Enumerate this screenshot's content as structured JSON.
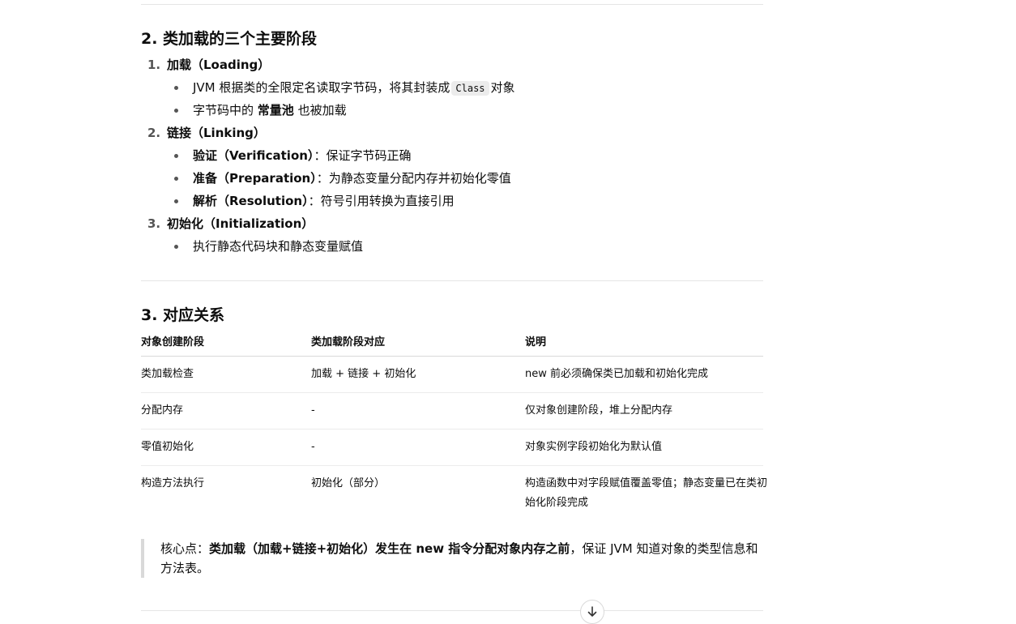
{
  "section2": {
    "title": "2. 类加载的三个主要阶段",
    "items": [
      {
        "num": "1.",
        "label": "加载（Loading）",
        "bullets": [
          {
            "pre": "JVM 根据类的全限定名读取字节码，将其封装成",
            "code": "Class",
            "post": "对象"
          },
          {
            "pre": "字节码中的",
            "bold": "常量池",
            "post": "也被加载"
          }
        ]
      },
      {
        "num": "2.",
        "label": "链接（Linking）",
        "bullets": [
          {
            "bold": "验证（Verification）",
            "post": "：保证字节码正确"
          },
          {
            "bold": "准备（Preparation）",
            "post": "：为静态变量分配内存并初始化零值"
          },
          {
            "bold": "解析（Resolution）",
            "post": "：符号引用转换为直接引用"
          }
        ]
      },
      {
        "num": "3.",
        "label": "初始化（Initialization）",
        "bullets": [
          {
            "text": "执行静态代码块和静态变量赋值"
          }
        ]
      }
    ]
  },
  "section3": {
    "title": "3. 对应关系",
    "table": {
      "headers": [
        "对象创建阶段",
        "类加载阶段对应",
        "说明"
      ],
      "rows": [
        [
          "类加载检查",
          "加载 + 链接 + 初始化",
          "new 前必须确保类已加载和初始化完成"
        ],
        [
          "分配内存",
          "-",
          "仅对象创建阶段，堆上分配内存"
        ],
        [
          "零值初始化",
          "-",
          "对象实例字段初始化为默认值"
        ],
        [
          "构造方法执行",
          "初始化（部分）",
          "构造函数中对字段赋值覆盖零值；静态变量已在类初始化阶段完成"
        ]
      ]
    }
  },
  "quote": {
    "prefix": "核心点：",
    "bold": "类加载（加载+链接+初始化）发生在 new 指令分配对象内存之前",
    "suffix": "，保证 JVM 知道对象的类型信息和方法表。"
  },
  "icons": {
    "scroll_down": "arrow-down-icon"
  }
}
